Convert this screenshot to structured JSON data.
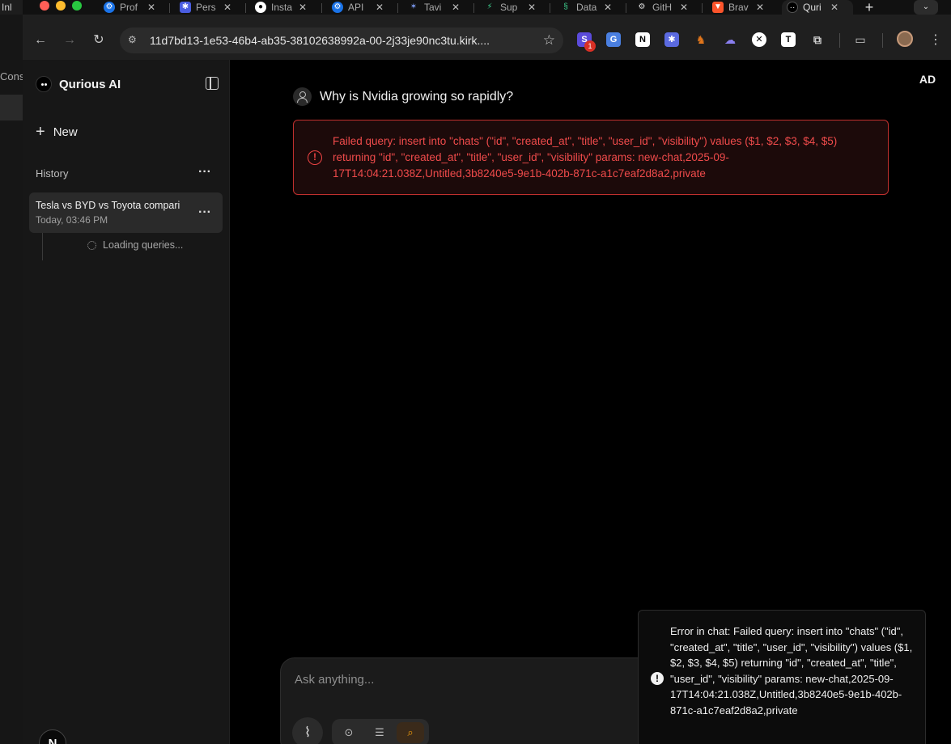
{
  "behind_window": {
    "tab_label": "Inl",
    "side_label": "Cons"
  },
  "browser": {
    "tabs": [
      {
        "title": "Prof"
      },
      {
        "title": "Pers"
      },
      {
        "title": "Insta"
      },
      {
        "title": "API"
      },
      {
        "title": "Tavi"
      },
      {
        "title": "Sup"
      },
      {
        "title": "Data"
      },
      {
        "title": "GitH"
      },
      {
        "title": "Brav"
      },
      {
        "title": "Quri"
      }
    ],
    "new_tab": "+",
    "url": "11d7bd13-1e53-46b4-ab35-38102638992a-00-2j33je90nc3tu.kirk....",
    "extension_badge": "1",
    "colors": {
      "accent_error": "#ef4444",
      "accent_mode": "#f59e0b"
    }
  },
  "sidebar": {
    "brand": "Qurious AI",
    "new_label": "New",
    "history_label": "History",
    "chat_items": [
      {
        "title": "Tesla vs BYD vs Toyota compari",
        "time": "Today, 03:46 PM"
      }
    ],
    "loading_label": "Loading queries...",
    "user_initial": "N"
  },
  "main": {
    "user_initials": "AD",
    "question": "Why is Nvidia growing so rapidly?",
    "error_message": "Failed query: insert into \"chats\" (\"id\", \"created_at\", \"title\", \"user_id\", \"visibility\") values ($1, $2, $3, $4, $5) returning \"id\", \"created_at\", \"title\", \"user_id\", \"visibility\" params: new-chat,2025-09-17T14:04:21.038Z,Untitled,3b8240e5-9e1b-402b-871c-a1c7eaf2d8a2,private",
    "composer": {
      "placeholder": "Ask anything..."
    },
    "toast_message": "Error in chat: Failed query: insert into \"chats\" (\"id\", \"created_at\", \"title\", \"user_id\", \"visibility\") values ($1, $2, $3, $4, $5) returning \"id\", \"created_at\", \"title\", \"user_id\", \"visibility\" params: new-chat,2025-09-17T14:04:21.038Z,Untitled,3b8240e5-9e1b-402b-871c-a1c7eaf2d8a2,private"
  }
}
